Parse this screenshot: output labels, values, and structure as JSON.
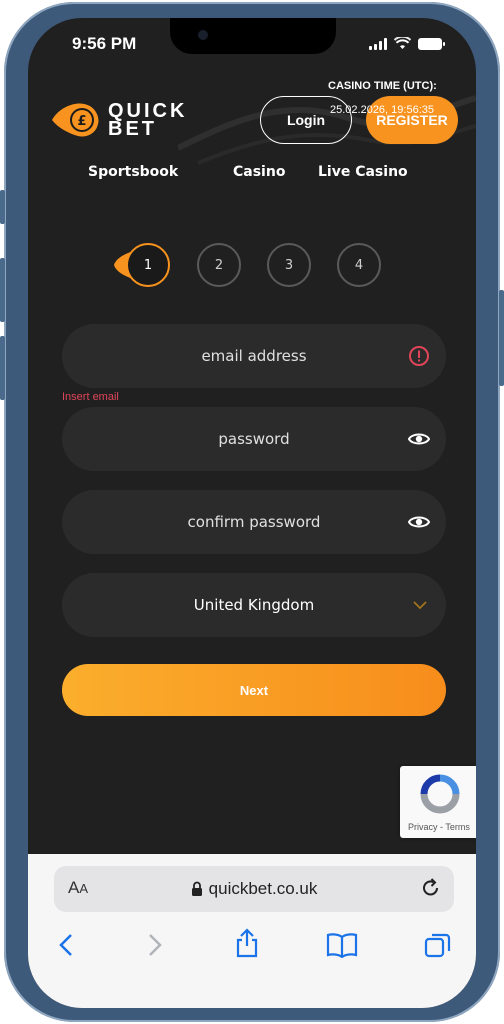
{
  "status_bar": {
    "time": "9:56 PM"
  },
  "header": {
    "logo_line1": "QUICK",
    "logo_line2": "BET",
    "casino_time_label": "CASINO TIME (UTC):",
    "casino_time_value": "25.02.2026, 19:56:35",
    "login_label": "Login",
    "register_label": "REGISTER"
  },
  "nav": {
    "items": [
      "Sportsbook",
      "Casino",
      "Live Casino"
    ]
  },
  "steps": {
    "items": [
      "1",
      "2",
      "3",
      "4"
    ],
    "active": 1
  },
  "form": {
    "email_placeholder": "email address",
    "email_error": "Insert email",
    "password_placeholder": "password",
    "confirm_placeholder": "confirm password",
    "country_value": "United Kingdom",
    "next_label": "Next"
  },
  "recaptcha": {
    "links": "Privacy - Terms"
  },
  "browser": {
    "aa_label_big": "A",
    "aa_label_small": "A",
    "url": "quickbet.co.uk"
  },
  "colors": {
    "accent": "#f7931e",
    "background": "#202020",
    "field": "#2b2b2b",
    "error": "#e0455a",
    "ios_blue": "#1a73e8"
  }
}
